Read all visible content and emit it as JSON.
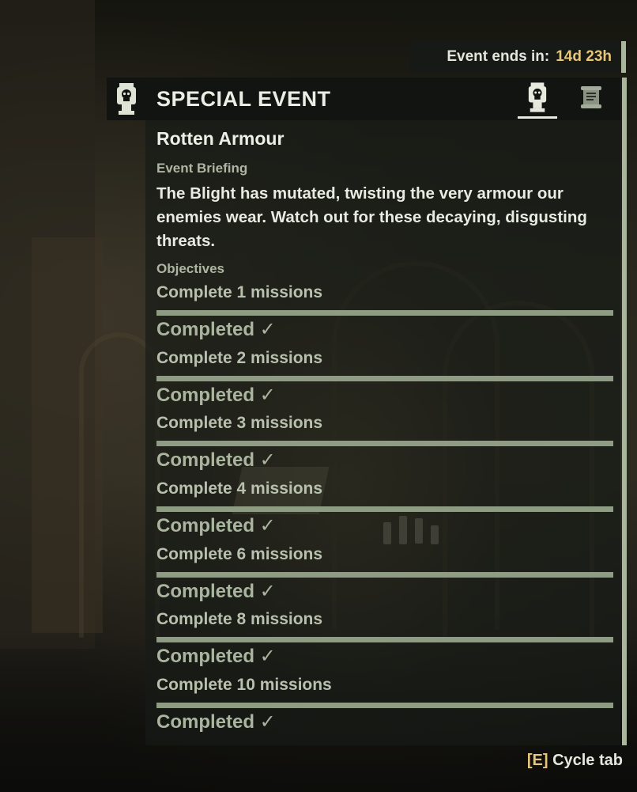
{
  "timer": {
    "label": "Event ends in:",
    "value": "14d 23h"
  },
  "header": {
    "title": "SPECIAL EVENT",
    "badge_icon": "skull-pillar-icon",
    "tabs": [
      {
        "icon": "skull-pillar-icon",
        "active": true
      },
      {
        "icon": "scroll-icon",
        "active": false
      }
    ]
  },
  "event": {
    "name": "Rotten Armour",
    "briefing_label": "Event Briefing",
    "briefing": "The Blight has mutated, twisting the very armour our enemies wear. Watch out for these decaying, disgusting threats."
  },
  "objectives": {
    "label": "Objectives",
    "items": [
      {
        "name": "Complete 1 missions",
        "status": "Completed ✓",
        "progress": 1.0
      },
      {
        "name": "Complete 2 missions",
        "status": "Completed ✓",
        "progress": 1.0
      },
      {
        "name": "Complete 3 missions",
        "status": "Completed ✓",
        "progress": 1.0
      },
      {
        "name": "Complete 4 missions",
        "status": "Completed ✓",
        "progress": 1.0
      },
      {
        "name": "Complete 6 missions",
        "status": "Completed ✓",
        "progress": 1.0
      },
      {
        "name": "Complete 8 missions",
        "status": "Completed ✓",
        "progress": 1.0
      },
      {
        "name": "Complete 10 missions",
        "status": "Completed ✓",
        "progress": 1.0
      }
    ]
  },
  "footer": {
    "key": "[E]",
    "label": "Cycle tab"
  },
  "colors": {
    "accent": "#e7c57a",
    "bar": "#8d9c82",
    "edge": "#aab59d"
  }
}
